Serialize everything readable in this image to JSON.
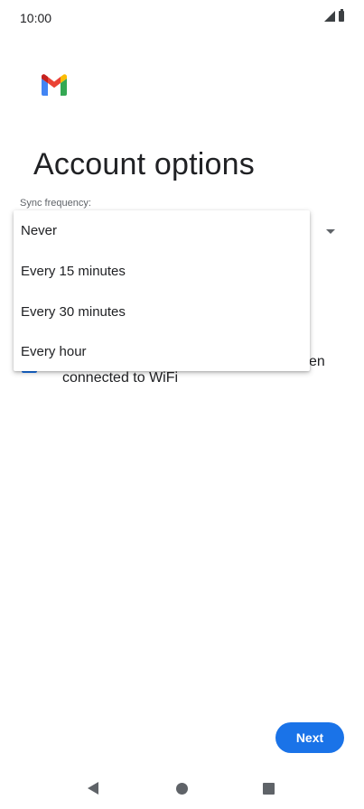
{
  "status_bar": {
    "time": "10:00",
    "icons": [
      "signal-icon",
      "battery-icon"
    ]
  },
  "header": {
    "logo": "gmail-logo",
    "title": "Account options"
  },
  "form": {
    "sync_label": "Sync frequency:",
    "selected_value": "",
    "wifi_text_tail": "en",
    "wifi_text": "connected to WiFi",
    "wifi_checked": true
  },
  "dropdown": {
    "items": [
      {
        "label": "Never"
      },
      {
        "label": "Every 15 minutes"
      },
      {
        "label": "Every 30 minutes"
      },
      {
        "label": "Every hour"
      }
    ]
  },
  "footer": {
    "next_label": "Next"
  },
  "nav_bar": {
    "icons": [
      "back-icon",
      "home-icon",
      "recents-icon"
    ]
  },
  "colors": {
    "accent": "#1a73e8",
    "text": "#202124",
    "secondary_text": "#5f6368"
  }
}
